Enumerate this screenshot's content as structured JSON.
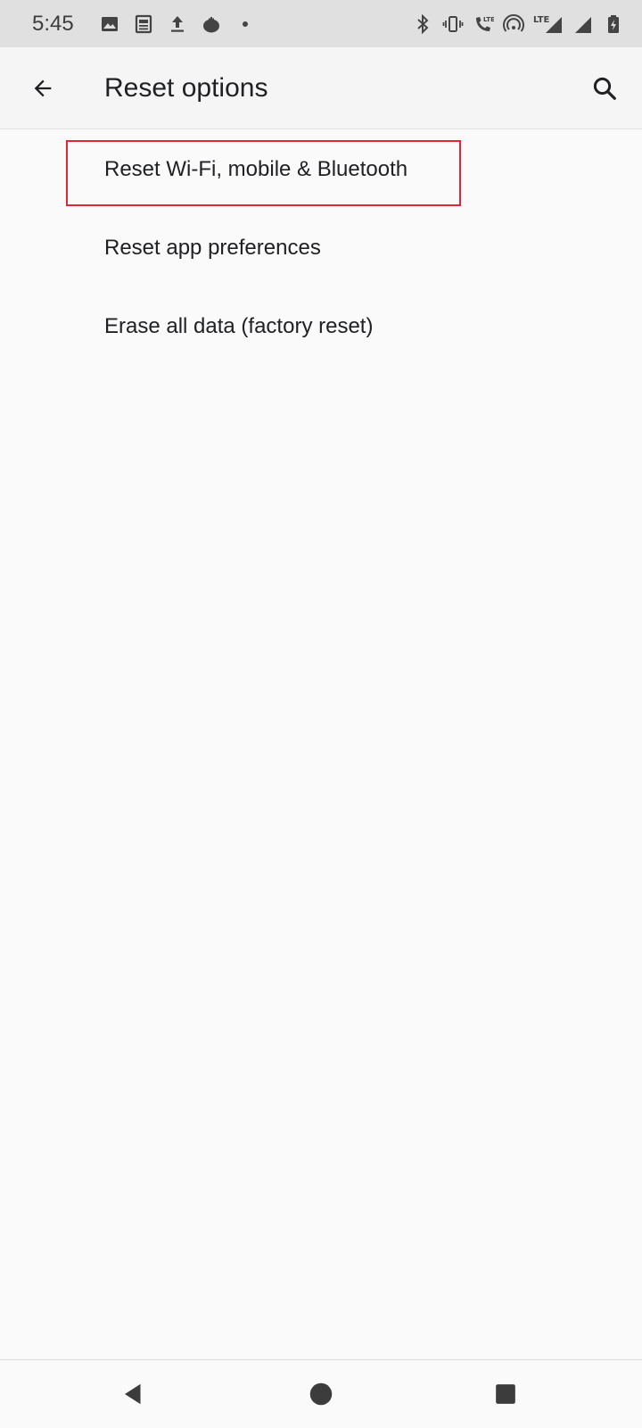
{
  "status_bar": {
    "time": "5:45",
    "left_icons": [
      "image-icon",
      "news-icon",
      "upload-icon",
      "tomato-icon",
      "dot-icon"
    ],
    "right_icons": [
      "bluetooth-icon",
      "vibrate-icon",
      "lte-call-icon",
      "hotspot-icon",
      "lte-signal-icon",
      "signal-icon",
      "battery-icon"
    ]
  },
  "app_bar": {
    "title": "Reset options",
    "back_icon": "arrow-back-icon",
    "search_icon": "search-icon"
  },
  "options": [
    {
      "label": "Reset Wi-Fi, mobile & Bluetooth",
      "highlighted": true
    },
    {
      "label": "Reset app preferences",
      "highlighted": false
    },
    {
      "label": "Erase all data (factory reset)",
      "highlighted": false
    }
  ],
  "highlight_color": "#e32636",
  "nav_bar": {
    "buttons": [
      "nav-back-icon",
      "nav-home-icon",
      "nav-recents-icon"
    ]
  }
}
